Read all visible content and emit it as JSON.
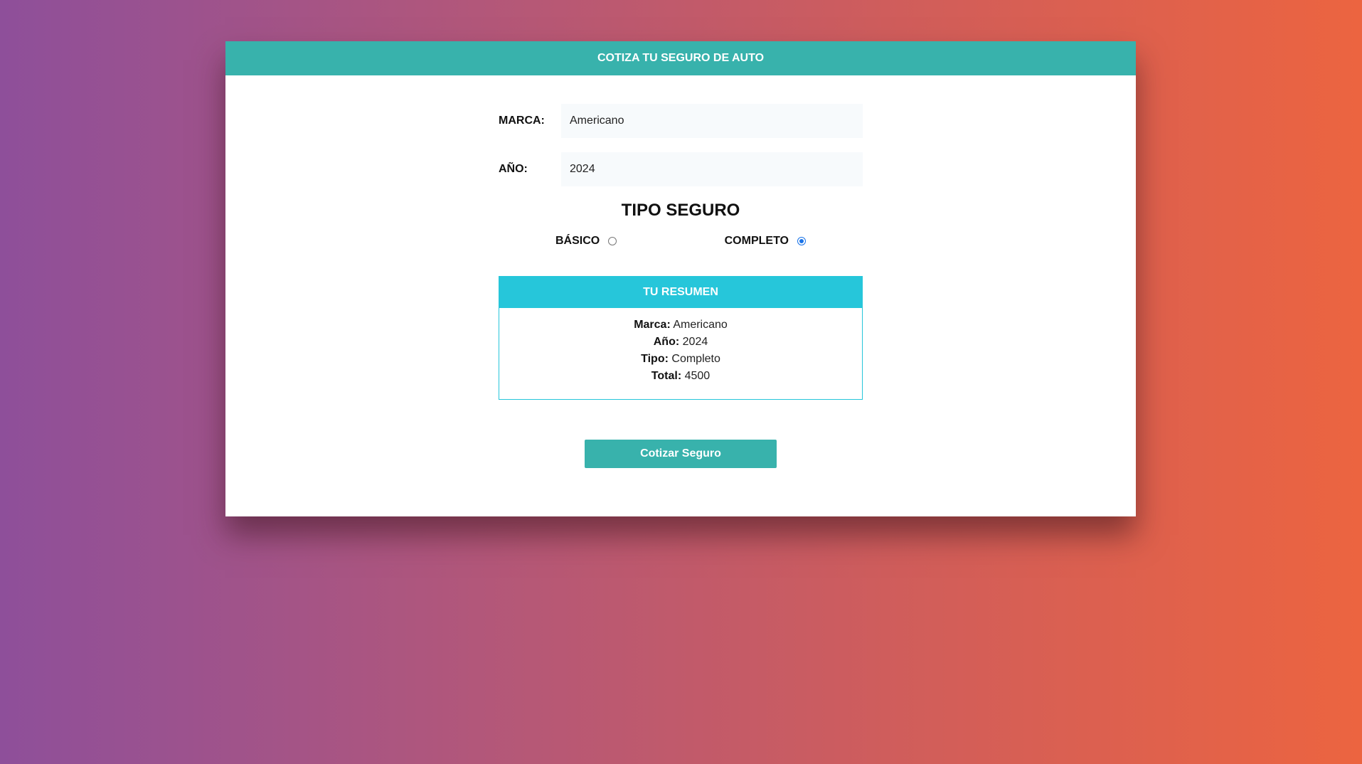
{
  "header": {
    "title": "COTIZA TU SEGURO DE AUTO"
  },
  "form": {
    "marca": {
      "label": "MARCA:",
      "value": "Americano"
    },
    "anio": {
      "label": "AÑO:",
      "value": "2024"
    }
  },
  "tipo_seguro": {
    "title": "TIPO SEGURO",
    "options": [
      {
        "label": "BÁSICO",
        "checked": false
      },
      {
        "label": "COMPLETO",
        "checked": true
      }
    ]
  },
  "resumen": {
    "title": "TU RESUMEN",
    "rows": [
      {
        "label": "Marca:",
        "value": "Americano"
      },
      {
        "label": "Año:",
        "value": "2024"
      },
      {
        "label": "Tipo:",
        "value": "Completo"
      },
      {
        "label": "Total:",
        "value": "4500"
      }
    ]
  },
  "button": {
    "label": "Cotizar Seguro"
  },
  "colors": {
    "header": "#38b2ac",
    "summary_accent": "#26c6da",
    "radio_checked": "#1a73e8"
  }
}
